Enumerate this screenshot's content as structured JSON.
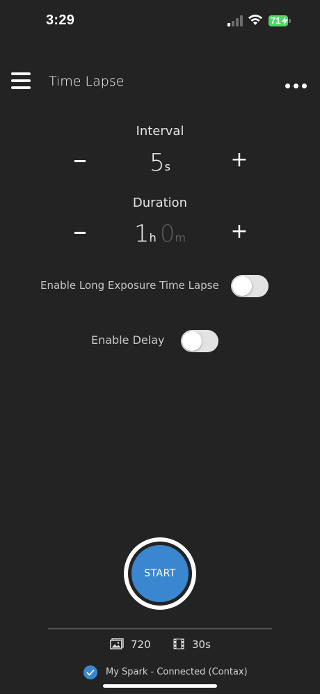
{
  "status_bar": {
    "time": "3:29",
    "battery": "71"
  },
  "header": {
    "title": "Time Lapse"
  },
  "interval": {
    "label": "Interval",
    "minus": "-",
    "plus": "+",
    "value": "5",
    "unit": "s"
  },
  "duration": {
    "label": "Duration",
    "minus": "-",
    "plus": "+",
    "hours": "1",
    "hours_unit": "h",
    "minutes": "0",
    "minutes_unit": "m"
  },
  "long_exposure": {
    "label": "Enable Long Exposure Time Lapse",
    "enabled": false
  },
  "delay": {
    "label": "Enable Delay",
    "enabled": false
  },
  "start_button": {
    "label": "START"
  },
  "stats": {
    "photos": "720",
    "video_length": "30s"
  },
  "connection": {
    "text": "My Spark - Connected (Contax)"
  },
  "colors": {
    "accent": "#3b87cf",
    "background": "#232323",
    "battery": "#4cd964"
  }
}
